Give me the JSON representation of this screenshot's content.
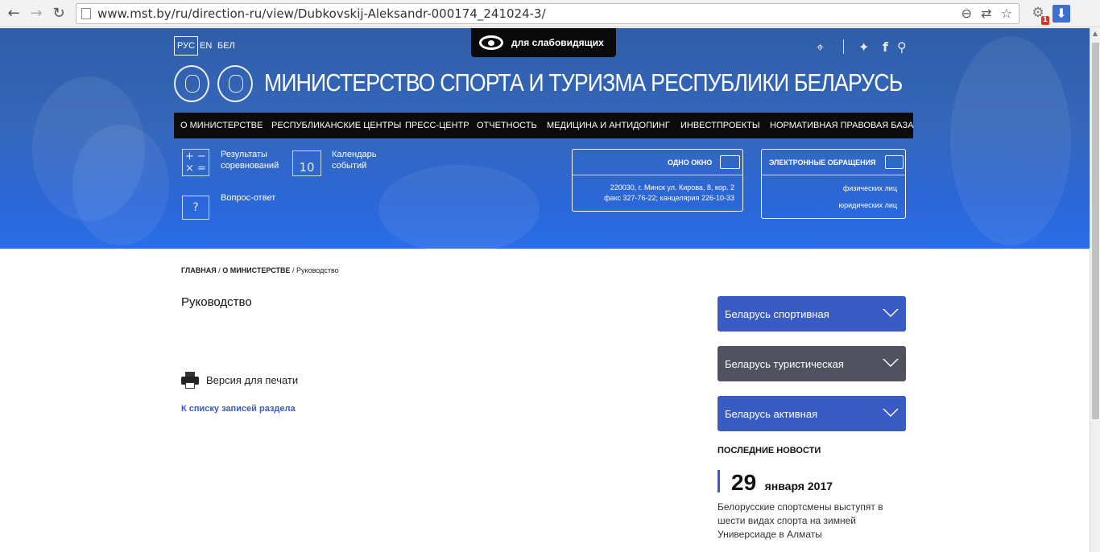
{
  "browser": {
    "back": "←",
    "forward": "→",
    "reload": "↻",
    "url": "www.mst.by/ru/direction-ru/view/Dubkovskij-Aleksandr-000174_241024-3/",
    "ext_badge": "1"
  },
  "header": {
    "languages": [
      "РУС",
      "EN",
      "БЕЛ"
    ],
    "accessibility_label": "для слабовидящих",
    "site_title": "МИНИСТЕРСТВО СПОРТА И ТУРИЗМА РЕСПУБЛИКИ БЕЛАРУСЬ",
    "nav": [
      "О МИНИСТЕРСТВЕ",
      "РЕСПУБЛИКАНСКИЕ ЦЕНТРЫ",
      "ПРЕСС-ЦЕНТР",
      "ОТЧЕТНОСТЬ",
      "МЕДИЦИНА И АНТИДОПИНГ",
      "ИНВЕСТПРОЕКТЫ",
      "НОРМАТИВНАЯ ПРАВОВАЯ БАЗА"
    ],
    "quick_links": {
      "results": [
        "Результаты",
        "соревнований"
      ],
      "calendar": [
        "Календарь",
        "событий"
      ],
      "calendar_day": "10",
      "faq": "Вопрос-ответ"
    },
    "one_window": {
      "title": "ОДНО ОКНО",
      "address": "220030, г. Минск ул. Кирова, 8, кор. 2",
      "phones": "факс 327-76-22; канцелярия 226-10-33"
    },
    "appeals": {
      "title": "ЭЛЕКТРОННЫЕ ОБРАЩЕНИЯ",
      "individuals": "физических лиц",
      "legal": "юридических лиц"
    }
  },
  "content": {
    "breadcrumb": {
      "home": "ГЛАВНАЯ",
      "sep": "/",
      "section": "О МИНИСТЕРСТВЕ",
      "current": "Руководство"
    },
    "title": "Руководство",
    "print_label": "Версия для печати",
    "back_link": "К списку записей раздела"
  },
  "sidebar": {
    "accordions": [
      {
        "label": "Беларусь спортивная",
        "color": "#3a5bc4"
      },
      {
        "label": "Беларусь туристическая",
        "color": "#505260"
      },
      {
        "label": "Беларусь активная",
        "color": "#3a5bc4"
      }
    ],
    "news_heading": "ПОСЛЕДНИЕ НОВОСТИ",
    "news": {
      "day": "29",
      "month_year": "января 2017",
      "text": "Белорусские спортсмены выступят в шести видах спорта на зимней Универсиаде в Алматы"
    }
  }
}
